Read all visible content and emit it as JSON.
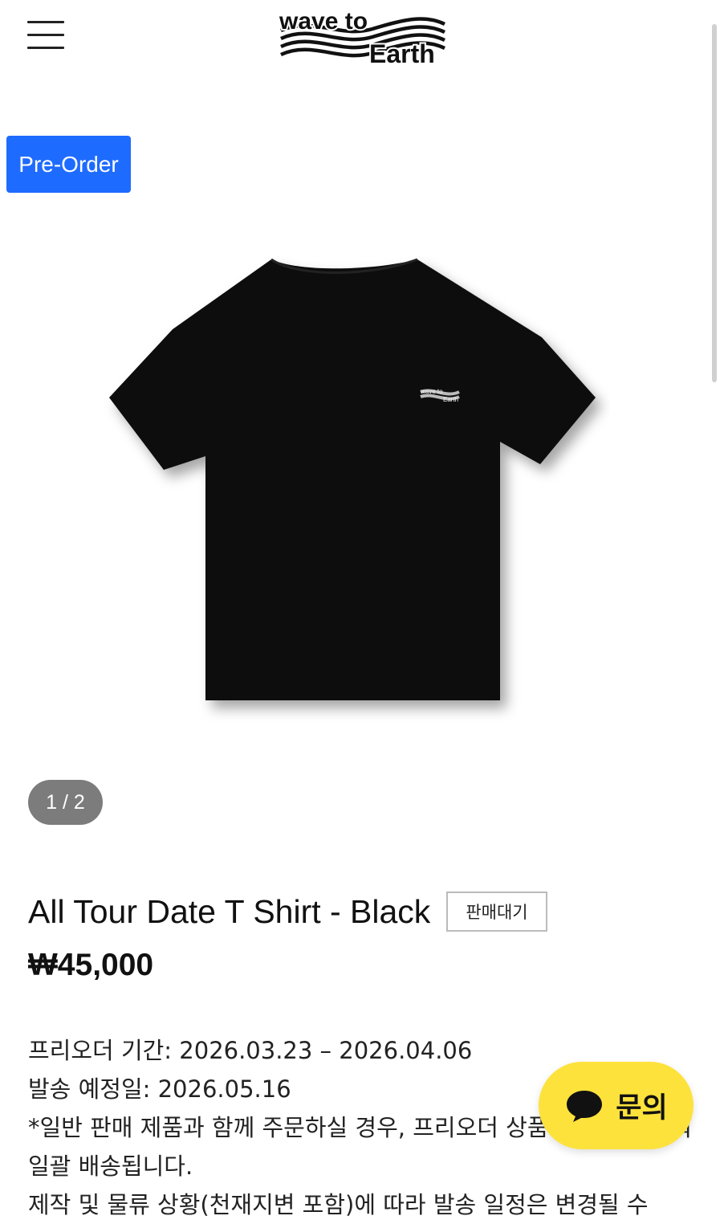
{
  "header": {
    "brand_line1": "wave to",
    "brand_line2": "Earth",
    "menu_icon": "hamburger-menu-icon"
  },
  "badge": {
    "label": "Pre-Order",
    "color": "#1e6bff"
  },
  "gallery": {
    "pager_text": "1 / 2",
    "shirt_print_line1": "wave to",
    "shirt_print_line2": "Earth"
  },
  "product": {
    "title": "All Tour Date T Shirt - Black",
    "status": "판매대기",
    "price": "₩45,000"
  },
  "description": {
    "preorder_period": "프리오더 기간: 2026.03.23 – 2026.04.06",
    "ship_date": "발송 예정일: 2026.05.16",
    "note": "*일반 판매 제품과 함께 주문하실 경우, 프리오더 상품 발송일에 맞춰 일괄 배송됩니다.",
    "note2": "제작 및 물류 상황(천재지변 포함)에 따라 발송 일정은 변경될 수"
  },
  "chat": {
    "label": "문의",
    "icon": "speech-bubble-icon",
    "color": "#fde23c"
  }
}
